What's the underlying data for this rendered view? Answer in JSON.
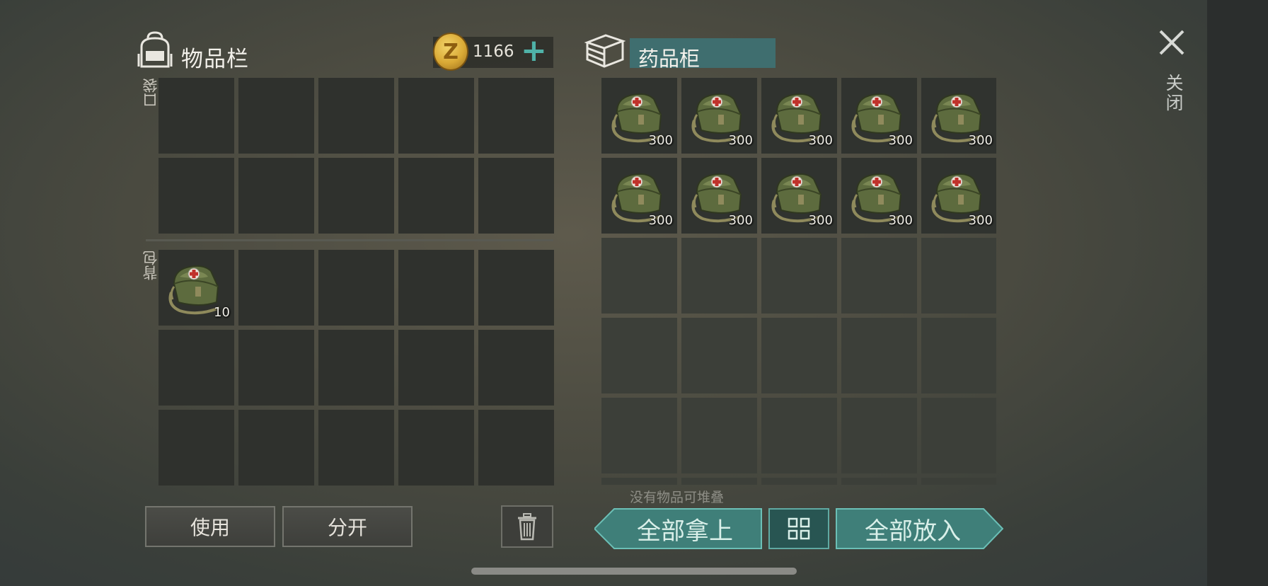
{
  "inventory": {
    "title": "物品栏",
    "pocket_label": "口袋",
    "backpack_label": "背包",
    "pocket_cells": [
      {
        "qty": ""
      },
      {
        "qty": ""
      },
      {
        "qty": ""
      },
      {
        "qty": ""
      },
      {
        "qty": ""
      },
      {
        "qty": ""
      },
      {
        "qty": ""
      },
      {
        "qty": ""
      },
      {
        "qty": ""
      },
      {
        "qty": ""
      }
    ],
    "backpack_cells": [
      {
        "item": "medkit-bag",
        "qty": "10"
      },
      {
        "qty": ""
      },
      {
        "qty": ""
      },
      {
        "qty": ""
      },
      {
        "qty": ""
      },
      {
        "qty": ""
      },
      {
        "qty": ""
      },
      {
        "qty": ""
      },
      {
        "qty": ""
      },
      {
        "qty": ""
      },
      {
        "qty": ""
      },
      {
        "qty": ""
      },
      {
        "qty": ""
      },
      {
        "qty": ""
      },
      {
        "qty": ""
      }
    ]
  },
  "currency": {
    "symbol": "Z",
    "amount": "1166",
    "add_label": "+"
  },
  "cabinet": {
    "title": "药品柜",
    "stack_note": "没有物品可堆叠",
    "cells": [
      {
        "item": "medkit-bag",
        "qty": "300"
      },
      {
        "item": "medkit-bag",
        "qty": "300"
      },
      {
        "item": "medkit-bag",
        "qty": "300"
      },
      {
        "item": "medkit-bag",
        "qty": "300"
      },
      {
        "item": "medkit-bag",
        "qty": "300"
      },
      {
        "item": "medkit-bag",
        "qty": "300"
      },
      {
        "item": "medkit-bag",
        "qty": "300"
      },
      {
        "item": "medkit-bag",
        "qty": "300"
      },
      {
        "item": "medkit-bag",
        "qty": "300"
      },
      {
        "item": "medkit-bag",
        "qty": "300"
      },
      {
        "qty": ""
      },
      {
        "qty": ""
      },
      {
        "qty": ""
      },
      {
        "qty": ""
      },
      {
        "qty": ""
      },
      {
        "qty": ""
      },
      {
        "qty": ""
      },
      {
        "qty": ""
      },
      {
        "qty": ""
      },
      {
        "qty": ""
      },
      {
        "qty": ""
      },
      {
        "qty": ""
      },
      {
        "qty": ""
      },
      {
        "qty": ""
      },
      {
        "qty": ""
      },
      {
        "qty": ""
      },
      {
        "qty": ""
      },
      {
        "qty": ""
      },
      {
        "qty": ""
      },
      {
        "qty": ""
      }
    ]
  },
  "actions": {
    "use_label": "使用",
    "split_label": "分开",
    "take_all_label": "全部拿上",
    "put_all_label": "全部放入",
    "close_label": "关闭"
  },
  "icons": {
    "backpack": "backpack-icon",
    "coin": "coin-icon",
    "cabinet": "cabinet-icon",
    "close": "close-icon",
    "trash": "trash-icon",
    "grid_toggle": "grid-icon",
    "medkit": "medkit-bag-icon"
  },
  "colors": {
    "accent_teal": "#4f9f97",
    "cabinet_title_bg": "#3f6e6f",
    "cell_bg": "#2f312d"
  }
}
